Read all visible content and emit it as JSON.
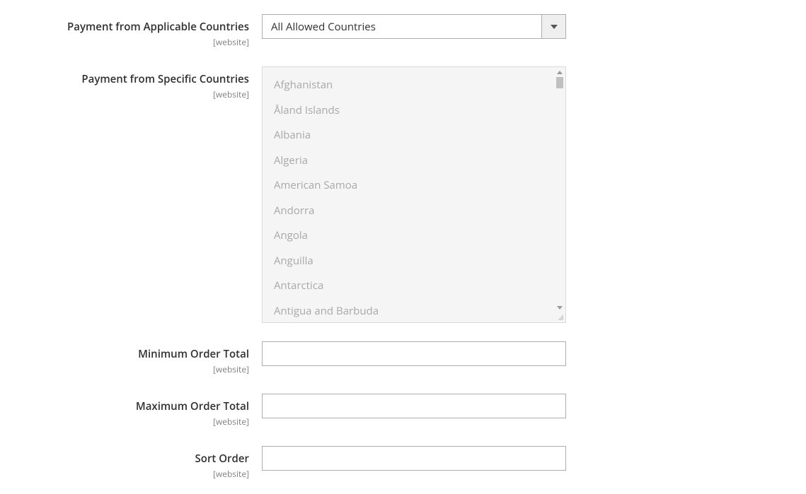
{
  "fields": {
    "applicable_countries": {
      "label": "Payment from Applicable Countries",
      "scope": "[website]",
      "selected": "All Allowed Countries"
    },
    "specific_countries": {
      "label": "Payment from Specific Countries",
      "scope": "[website]",
      "options": [
        "Afghanistan",
        "Åland Islands",
        "Albania",
        "Algeria",
        "American Samoa",
        "Andorra",
        "Angola",
        "Anguilla",
        "Antarctica",
        "Antigua and Barbuda"
      ]
    },
    "min_order_total": {
      "label": "Minimum Order Total",
      "scope": "[website]",
      "value": ""
    },
    "max_order_total": {
      "label": "Maximum Order Total",
      "scope": "[website]",
      "value": ""
    },
    "sort_order": {
      "label": "Sort Order",
      "scope": "[website]",
      "value": ""
    }
  }
}
